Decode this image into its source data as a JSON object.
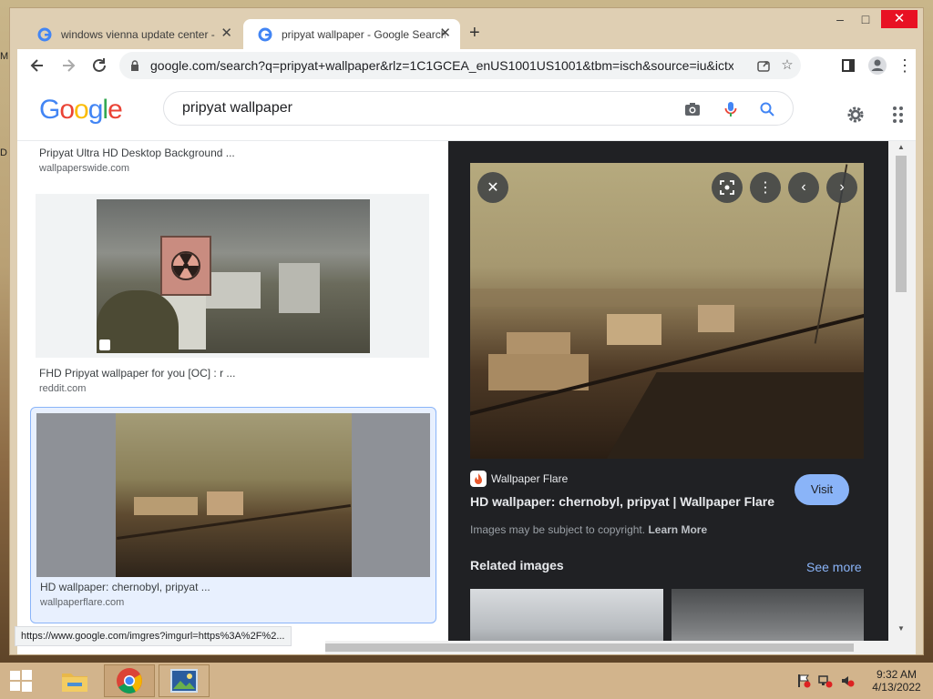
{
  "window": {
    "tabs": [
      {
        "title": "windows vienna update center -"
      },
      {
        "title": "pripyat wallpaper - Google Search"
      }
    ],
    "controls": {
      "minimize": "–",
      "maximize": "□",
      "close": "✕"
    },
    "new_tab": "+"
  },
  "toolbar": {
    "url": "google.com/search?q=pripyat+wallpaper&rlz=1C1GCEA_enUS1001US1001&tbm=isch&source=iu&ictx=1..."
  },
  "google": {
    "logo_letters": [
      {
        "ch": "G",
        "color": "#4285F4"
      },
      {
        "ch": "o",
        "color": "#EA4335"
      },
      {
        "ch": "o",
        "color": "#FBBC05"
      },
      {
        "ch": "g",
        "color": "#4285F4"
      },
      {
        "ch": "l",
        "color": "#34A853"
      },
      {
        "ch": "e",
        "color": "#EA4335"
      }
    ],
    "query": "pripyat wallpaper"
  },
  "results": [
    {
      "title": "Pripyat Ultra HD Desktop Background ...",
      "domain": "wallpaperswide.com"
    },
    {
      "title": "FHD Pripyat wallpaper for you [OC] : r ...",
      "domain": "reddit.com"
    },
    {
      "title": "HD wallpaper: chernobyl, pripyat ...",
      "domain": "wallpaperflare.com"
    }
  ],
  "panel": {
    "source": "Wallpaper Flare",
    "title": "HD wallpaper: chernobyl, pripyat | Wallpaper Flare",
    "visit": "Visit",
    "copyright": "Images may be subject to copyright.",
    "learn_more": "Learn More",
    "related": "Related images",
    "see_more": "See more"
  },
  "status_url": "https://www.google.com/imgres?imgurl=https%3A%2F%2...",
  "taskbar": {
    "time": "9:32 AM",
    "date": "4/13/2022"
  },
  "colors": {
    "accent": "#8ab4f8",
    "visit_bg": "#8ab4f8",
    "panel_bg": "#202124",
    "selected_border": "#8ab4f8"
  }
}
